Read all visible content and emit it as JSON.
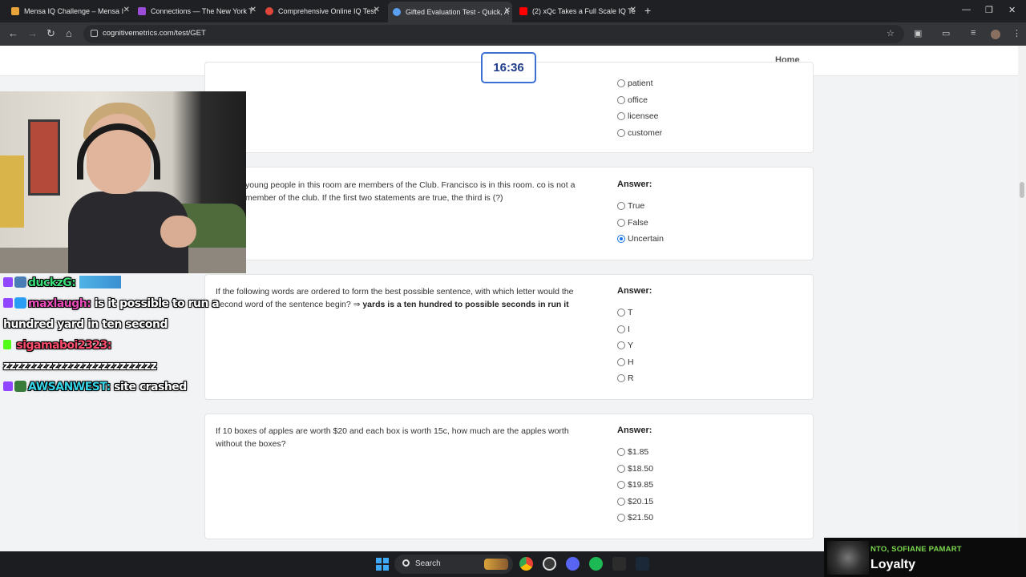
{
  "browser": {
    "tabs": [
      {
        "title": "Mensa IQ Challenge – Mensa I",
        "active": false
      },
      {
        "title": "Connections — The New York T",
        "active": false
      },
      {
        "title": "Comprehensive Online IQ Test",
        "active": false
      },
      {
        "title": "Gifted Evaluation Test - Quick, A",
        "active": true
      },
      {
        "title": "(2) xQc Takes a Full Scale IQ Te",
        "active": false
      }
    ],
    "new_tab": "+",
    "url": "cognitivemetrics.com/test/GET"
  },
  "header": {
    "timer": "16:36",
    "home": "Home"
  },
  "questions": [
    {
      "options": [
        "patient",
        "office",
        "licensee",
        "customer"
      ],
      "selected": -1
    },
    {
      "text": "young people in this room are members of the Club. Francisco is in this room. co is not a member of the club. If the first two statements are true, the third is (?)",
      "answer_label": "Answer:",
      "options": [
        "True",
        "False",
        "Uncertain"
      ],
      "selected": 2
    },
    {
      "text": "If the following words are ordered to form the best possible sentence, with which letter would the second word of the sentence begin? ⇒",
      "bold": "yards is a ten hundred to possible seconds in run it",
      "answer_label": "Answer:",
      "options": [
        "T",
        "I",
        "Y",
        "H",
        "R"
      ],
      "selected": -1
    },
    {
      "text": "If 10 boxes of apples are worth $20 and each box is worth 15c, how much are the apples worth without the boxes?",
      "answer_label": "Answer:",
      "options": [
        "$1.85",
        "$18.50",
        "$19.85",
        "$20.15",
        "$21.50"
      ],
      "selected": -1
    }
  ],
  "chat": [
    {
      "user": "duckzG:",
      "user_color": "#39e07a",
      "message": ""
    },
    {
      "user": "maxlaugh:",
      "user_color": "#e94cb8",
      "message": "is it possible to run a hundred yard in ten second"
    },
    {
      "user": "sigamaboi2323:",
      "user_color": "#ff4d6d",
      "message": "zzzzzzzzzzzzzzzzzzzzzzzzz"
    },
    {
      "user": "AWSANWEST:",
      "user_color": "#35d4e6",
      "message": "site crashed"
    }
  ],
  "now_playing": {
    "artist": "NTO, SOFIANE PAMART",
    "song": "Loyalty"
  },
  "taskbar": {
    "search": "Search"
  }
}
